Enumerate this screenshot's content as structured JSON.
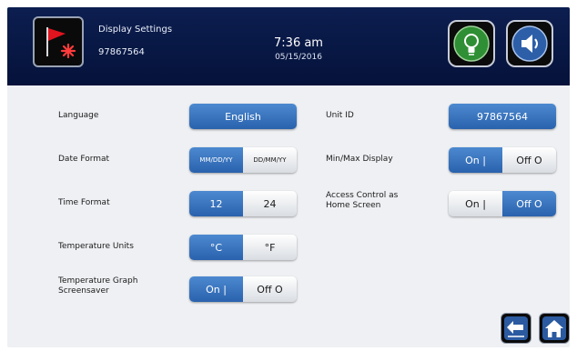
{
  "header": {
    "title": "Display Settings",
    "unit_id": "97867564",
    "time": "7:36 am",
    "date": "05/15/2016"
  },
  "settings": {
    "language": {
      "label": "Language",
      "value": "English"
    },
    "unit_id": {
      "label": "Unit ID",
      "value": "97867564"
    },
    "date_format": {
      "label": "Date Format",
      "options": [
        "MM/DD/YY",
        "DD/MM/YY"
      ],
      "selected": "MM/DD/YY"
    },
    "min_max_display": {
      "label": "Min/Max Display",
      "options": [
        "On |",
        "Off O"
      ],
      "selected": "On |"
    },
    "time_format": {
      "label": "Time Format",
      "options": [
        "12",
        "24"
      ],
      "selected": "12"
    },
    "access_control": {
      "label_line1": "Access Control as",
      "label_line2": "Home Screen",
      "options": [
        "On |",
        "Off O"
      ],
      "selected": "Off O"
    },
    "temperature_units": {
      "label": "Temperature Units",
      "options": [
        "°C",
        "°F"
      ],
      "selected": "°C"
    },
    "graph_screensaver": {
      "label_line1": "Temperature Graph",
      "label_line2": "Screensaver",
      "options": [
        "On |",
        "Off O"
      ],
      "selected": "On |"
    }
  },
  "icons": {
    "header_icon": "red-flag-alarm-icon",
    "light_button": "lightbulb-icon",
    "sound_button": "speaker-icon",
    "back_button": "back-arrow-icon",
    "home_button": "home-icon"
  },
  "colors": {
    "header_bg": "#0c1e50",
    "button_blue": "#3a74c0",
    "alarm_red": "#e0141e",
    "light_green": "#2f8f34"
  }
}
